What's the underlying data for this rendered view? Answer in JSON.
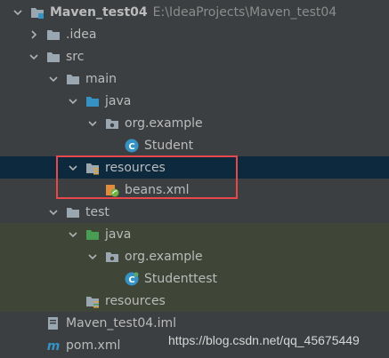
{
  "project": {
    "name": "Maven_test04",
    "path": "E:\\IdeaProjects\\Maven_test04"
  },
  "items": {
    "idea": ".idea",
    "src": "src",
    "main": "main",
    "java_main": "java",
    "org_example_main": "org.example",
    "student": "Student",
    "resources_main": "resources",
    "beans_xml": "beans.xml",
    "test": "test",
    "java_test": "java",
    "org_example_test": "org.example",
    "studenttest": "Studenttest",
    "resources_test": "resources",
    "iml": "Maven_test04.iml",
    "pom": "pom.xml"
  },
  "watermark": "https://blog.csdn.net/qq_45675449",
  "colors": {
    "selection": "#0d293e",
    "test_root": "#3f4537",
    "highlight": "#e8474c",
    "folder": "#9aa7b0",
    "java_folder": "#3592c4",
    "test_folder": "#499c54"
  }
}
